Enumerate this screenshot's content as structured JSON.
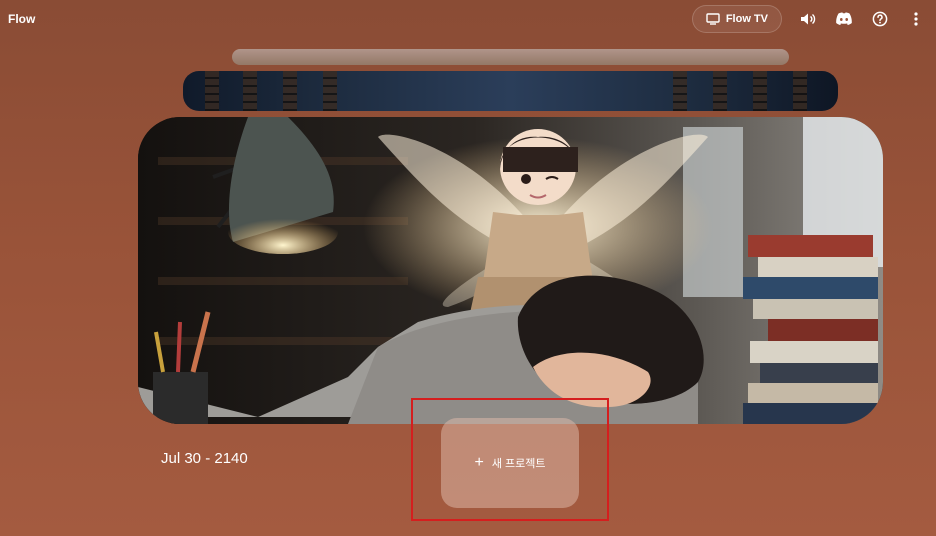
{
  "app": {
    "title": "Flow"
  },
  "topbar": {
    "flow_tv_label": "Flow TV",
    "icons": [
      "tv-icon",
      "volume-icon",
      "discord-icon",
      "help-icon",
      "more-vert-icon"
    ]
  },
  "project": {
    "date_label": "Jul 30 - 2140",
    "new_project_label": "새 프로젝트"
  },
  "colors": {
    "background_top": "#8a4c35",
    "background_bottom": "#a45b40",
    "highlight_box": "#d51e1e"
  }
}
